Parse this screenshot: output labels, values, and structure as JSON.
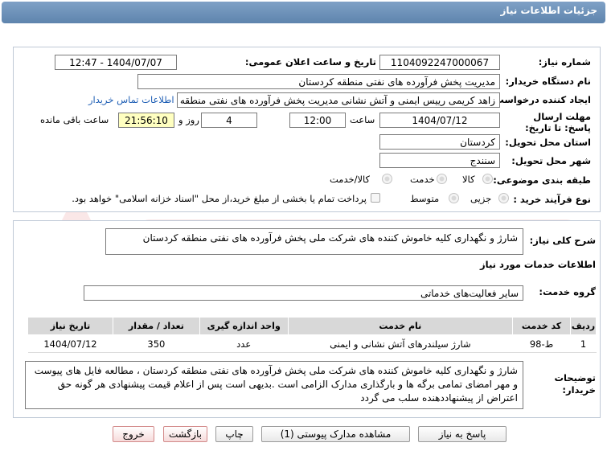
{
  "title": "جزئیات اطلاعات نیاز",
  "labels": {
    "need_number": "شماره نیاز:",
    "announce_datetime": "تاریخ و ساعت اعلان عمومی:",
    "buyer_org": "نام دستگاه خریدار:",
    "requester": "ایجاد کننده درخواست:",
    "contact_link": "اطلاعات تماس خریدار",
    "deadline": "مهلت ارسال پاسخ: تا تاریخ:",
    "time_word": "ساعت",
    "days_and": "روز و",
    "remaining": "ساعت باقی مانده",
    "province": "استان محل تحویل:",
    "city": "شهر محل تحویل:",
    "category": "طبقه بندی موضوعی:",
    "purchase_type": "نوع فرآیند خرید :",
    "need_summary": "شرح کلی نیاز:",
    "services_info": "اطلاعات خدمات مورد نیاز",
    "service_group": "گروه خدمت:",
    "buyer_notes": "توضیحات خریدار:"
  },
  "values": {
    "need_number": "1104092247000067",
    "announce_datetime": "1404/07/07 - 12:47",
    "buyer_org": "مدیریت پخش فرآورده های نفتی منطقه کردستان",
    "requester": "زاهد کریمی رییس ایمنی و آتش نشانی مدیریت پخش فرآورده های نفتی منطقه کردستان",
    "deadline_date": "1404/07/12",
    "deadline_time": "12:00",
    "days": "4",
    "remaining_time": "21:56:10",
    "province": "کردستان",
    "city": "سنندج",
    "need_summary": "شارژ و نگهداری کلیه خاموش کننده های شرکت ملی پخش فرآورده های نفتی منطقه کردستان",
    "service_group": "سایر فعالیت‌های خدماتی",
    "buyer_notes": "شارژ و نگهداری کلیه خاموش کننده های شرکت ملی پخش فرآورده های نفتی منطقه کردستان ، مطالعه فایل های پیوست و مهر امضای تمامی برگه ها و بارگذاری مدارک الزامی است .بدیهی است پس از اعلام قیمت پیشنهادی هر گونه حق اعتراض از پیشنهاددهنده سلب می گردد"
  },
  "category_options": [
    "کالا",
    "خدمت",
    "کالا/خدمت"
  ],
  "purchase_options": [
    "جزیی",
    "متوسط"
  ],
  "payment_note": "پرداخت تمام یا بخشی از مبلغ خرید،از محل \"اسناد خزانه اسلامی\" خواهد بود.",
  "table": {
    "headers": [
      "ردیف",
      "کد خدمت",
      "نام خدمت",
      "واحد اندازه گیری",
      "تعداد / مقدار",
      "تاریخ نیاز"
    ],
    "rows": [
      [
        "1",
        "ط-98",
        "شارژ سیلندرهای آتش نشانی و ایمنی",
        "عدد",
        "350",
        "1404/07/12"
      ]
    ]
  },
  "buttons": {
    "reply": "پاسخ به نیاز",
    "attachments": "مشاهده مدارک پیوستی (1)",
    "print": "چاپ",
    "back": "بازگشت",
    "exit": "خروج"
  },
  "colors": {
    "title_bar": "#6b8fb8",
    "link": "#1f5fb5",
    "highlight": "#ffffc0"
  }
}
